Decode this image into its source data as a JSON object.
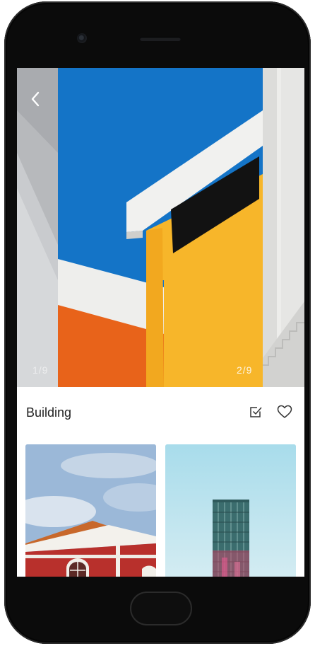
{
  "header": {
    "back_icon": "chevron-left-icon"
  },
  "carousel": {
    "prev_counter": "1/9",
    "current_counter": "2/9"
  },
  "album": {
    "title": "Building",
    "select_icon": "checkbox-icon",
    "like_icon": "heart-icon"
  },
  "colors": {
    "sky": "#1474c7",
    "yellow_wall": "#f7b62a",
    "orange_wall": "#e8631a",
    "phone_body": "#0b0b0b"
  }
}
